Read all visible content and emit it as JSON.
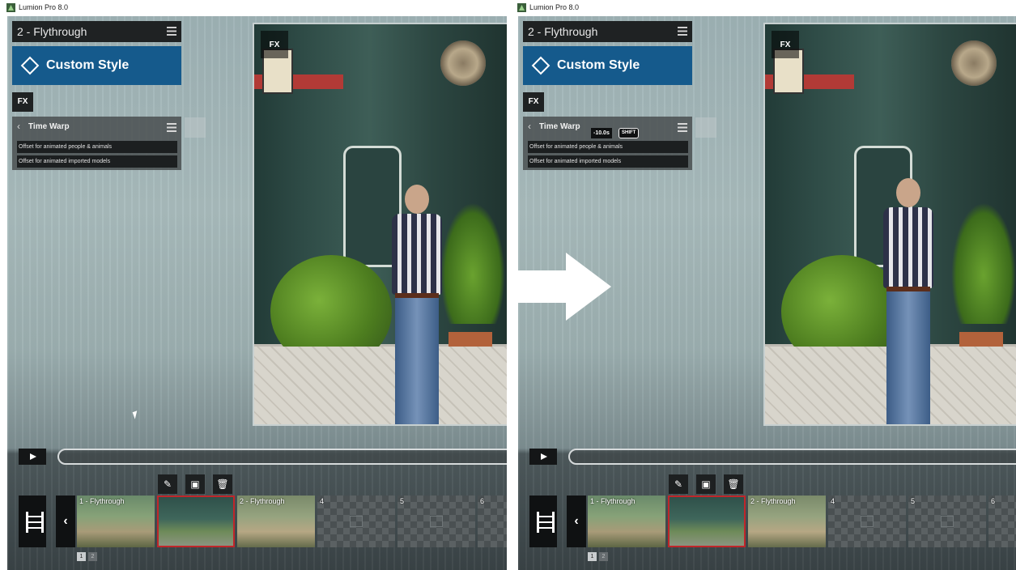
{
  "window": {
    "title": "Lumion Pro 8.0"
  },
  "panel": {
    "header": "2 - Flythrough",
    "style_button": "Custom Style",
    "fx_button": "FX",
    "effect": {
      "title": "Time Warp",
      "options": [
        "Offset for animated people & animals",
        "Offset for animated imported models"
      ]
    }
  },
  "tooltip": {
    "value": "-10.0s",
    "key": "SHIFT"
  },
  "preview": {
    "fx_badge": "FX"
  },
  "clips": [
    {
      "label": "1 - Flythrough",
      "state": "normal"
    },
    {
      "label": "",
      "state": "selected"
    },
    {
      "label": "2 - Flythrough",
      "state": "normal"
    },
    {
      "label": "4",
      "state": "empty"
    },
    {
      "label": "5",
      "state": "empty"
    },
    {
      "label": "6",
      "state": "empty"
    }
  ],
  "pages": [
    "1",
    "2"
  ],
  "colors": {
    "style_blue": "#155a8c",
    "selected_clip_border": "#c0262a"
  },
  "icons": [
    "film-strip-icon",
    "play-icon",
    "edit-icon",
    "camera-add-icon",
    "delete-icon",
    "back-chevron-icon",
    "menu-icon",
    "style-icon",
    "fx-person-icon"
  ]
}
